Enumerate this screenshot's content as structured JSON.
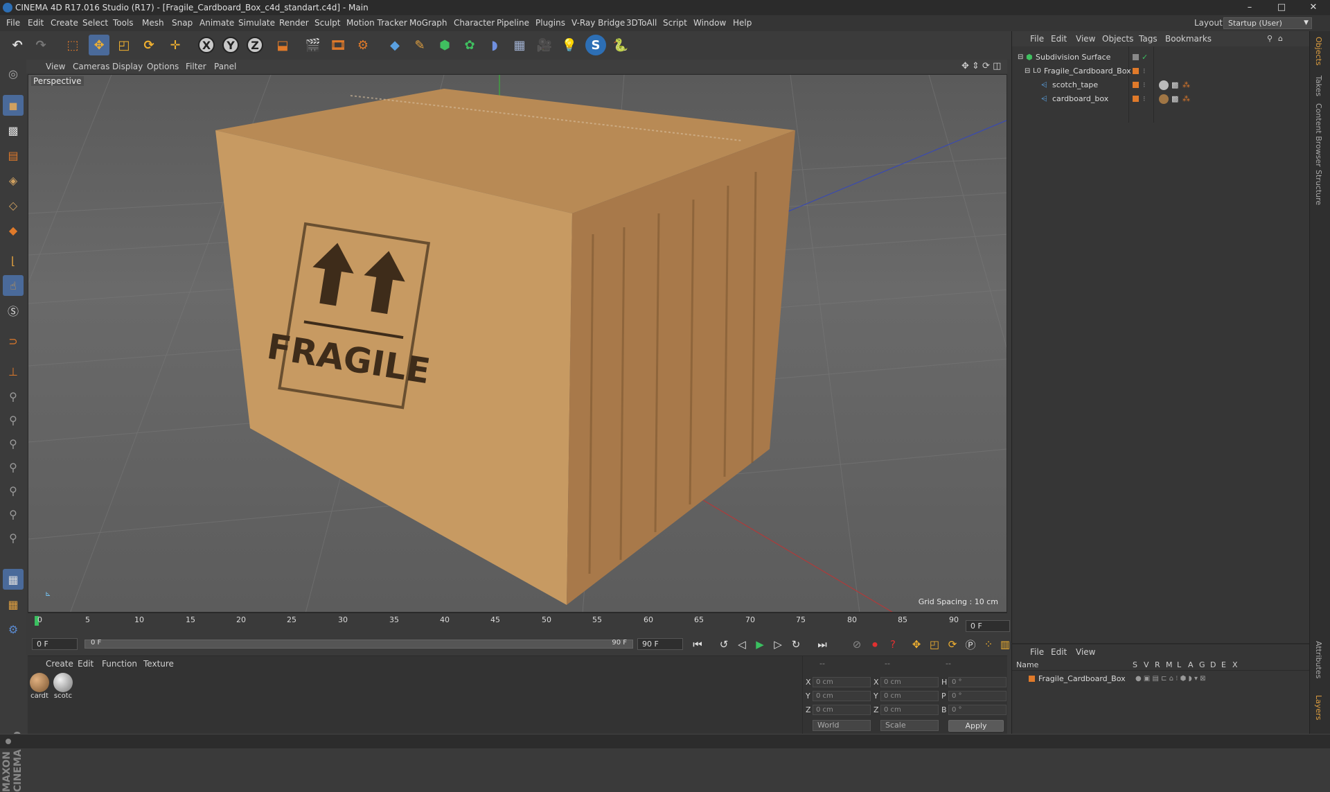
{
  "window": {
    "title": "CINEMA 4D R17.016 Studio (R17) - [Fragile_Cardboard_Box_c4d_standart.c4d] - Main",
    "minimize": "–",
    "maximize": "□",
    "close": "✕"
  },
  "menubar": {
    "items": [
      "File",
      "Edit",
      "Create",
      "Select",
      "Tools",
      "Mesh",
      "Snap",
      "Animate",
      "Simulate",
      "Render",
      "Sculpt",
      "Motion Tracker",
      "MoGraph",
      "Character",
      "Pipeline",
      "Plugins",
      "V-Ray Bridge",
      "3DToAll",
      "Script",
      "Window",
      "Help"
    ],
    "layout_label": "Layout:",
    "layout_value": "Startup (User)"
  },
  "toolbar": {
    "axis_x": "X",
    "axis_y": "Y",
    "axis_z": "Z"
  },
  "viewport": {
    "menu": [
      "View",
      "Cameras",
      "Display",
      "Options",
      "Filter",
      "Panel"
    ],
    "label": "Perspective",
    "grid_spacing": "Grid Spacing : 10 cm",
    "box_text": "FRAGILE"
  },
  "timeline": {
    "ticks": [
      "0",
      "5",
      "10",
      "15",
      "20",
      "25",
      "30",
      "35",
      "40",
      "45",
      "50",
      "55",
      "60",
      "65",
      "70",
      "75",
      "80",
      "85",
      "90"
    ],
    "current_frame": "0 F"
  },
  "transport": {
    "start_frame": "0 F",
    "slider_left": "0 F",
    "slider_right": "90 F",
    "end_frame": "90 F"
  },
  "material_manager": {
    "menu": [
      "Create",
      "Edit",
      "Function",
      "Texture"
    ],
    "materials": [
      {
        "name": "cardt",
        "color": "#a07645"
      },
      {
        "name": "scotc",
        "color": "#b5b5b5"
      }
    ]
  },
  "coordinates": {
    "headers": [
      "--",
      "--",
      "--"
    ],
    "rows": [
      {
        "a": "X",
        "av": "0 cm",
        "b": "X",
        "bv": "0 cm",
        "c": "H",
        "cv": "0 °"
      },
      {
        "a": "Y",
        "av": "0 cm",
        "b": "Y",
        "bv": "0 cm",
        "c": "P",
        "cv": "0 °"
      },
      {
        "a": "Z",
        "av": "0 cm",
        "b": "Z",
        "bv": "0 cm",
        "c": "B",
        "cv": "0 °"
      }
    ],
    "mode_world": "World",
    "mode_scale": "Scale",
    "apply": "Apply"
  },
  "object_manager": {
    "menu": [
      "File",
      "Edit",
      "View",
      "Objects",
      "Tags",
      "Bookmarks"
    ],
    "objects": [
      {
        "name": "Subdivision Surface",
        "indent": 0
      },
      {
        "name": "Fragile_Cardboard_Box",
        "indent": 1
      },
      {
        "name": "scotch_tape",
        "indent": 2
      },
      {
        "name": "cardboard_box",
        "indent": 2
      }
    ]
  },
  "layer_manager": {
    "menu": [
      "File",
      "Edit",
      "View"
    ],
    "columns": [
      "Name",
      "S",
      "V",
      "R",
      "M",
      "L",
      "A",
      "G",
      "D",
      "E",
      "X"
    ],
    "layers": [
      {
        "name": "Fragile_Cardboard_Box"
      }
    ]
  },
  "side_tabs": [
    "Objects",
    "Takes",
    "Content Browser",
    "Structure",
    "Attributes",
    "Layers"
  ],
  "brand": "MAXON CINEMA 4D",
  "colors": {
    "accent_orange": "#e07a2a",
    "box_front": "#c79a62",
    "box_side": "#a8794a",
    "box_top": "#b88a55"
  }
}
